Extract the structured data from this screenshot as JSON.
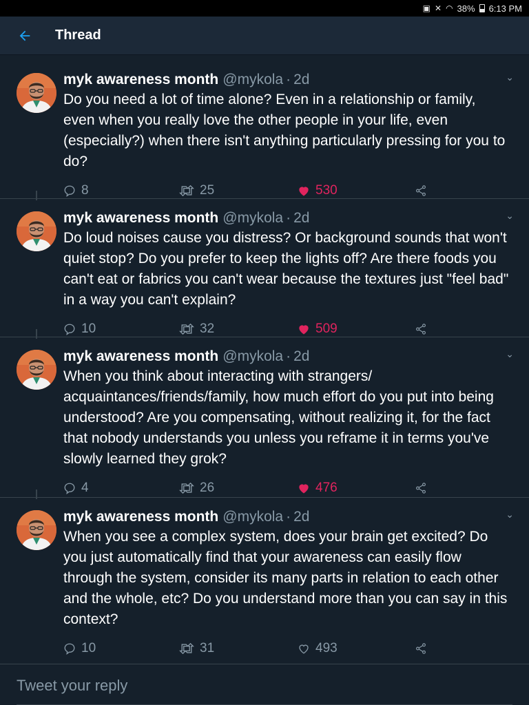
{
  "status_bar": {
    "battery_percent": "38%",
    "time": "6:13 PM"
  },
  "header": {
    "title": "Thread",
    "back_icon": "arrow-left-icon"
  },
  "colors": {
    "background": "#15202b",
    "header_bg": "#1c2938",
    "accent": "#1da1f2",
    "like": "#e0245e",
    "muted": "#8899a6"
  },
  "tweets": [
    {
      "name": "myk awareness month",
      "handle": "@mykola",
      "time": "2d",
      "text": "Do you need a lot of time alone? Even in a relationship or family, even when you really love the other people in your life, even (especially?) when there isn't anything particularly pressing for you to do?",
      "replies": "8",
      "retweets": "25",
      "likes": "530",
      "liked": true
    },
    {
      "name": "myk awareness month",
      "handle": "@mykola",
      "time": "2d",
      "text": "Do loud noises cause you distress? Or background sounds that won't quiet stop? Do you prefer to keep the lights off? Are there foods you can't eat or fabrics you can't wear because the textures just \"feel bad\" in a way you can't explain?",
      "replies": "10",
      "retweets": "32",
      "likes": "509",
      "liked": true
    },
    {
      "name": "myk awareness month",
      "handle": "@mykola",
      "time": "2d",
      "text": "When you think about interacting with strangers/ acquaintances/friends/family, how much effort do you put into being understood? Are you compensating, without realizing it, for the fact that nobody understands you unless you reframe it in terms you've slowly learned they grok?",
      "replies": "4",
      "retweets": "26",
      "likes": "476",
      "liked": true
    },
    {
      "name": "myk awareness month",
      "handle": "@mykola",
      "time": "2d",
      "text": "When you see a complex system, does your brain get excited? Do you just automatically find that your awareness can easily flow through the system, consider its many parts in relation to each other and the whole, etc? Do you understand more than you can say in this context?",
      "replies": "10",
      "retweets": "31",
      "likes": "493",
      "liked": false
    }
  ],
  "reply_box": {
    "placeholder": "Tweet your reply"
  }
}
